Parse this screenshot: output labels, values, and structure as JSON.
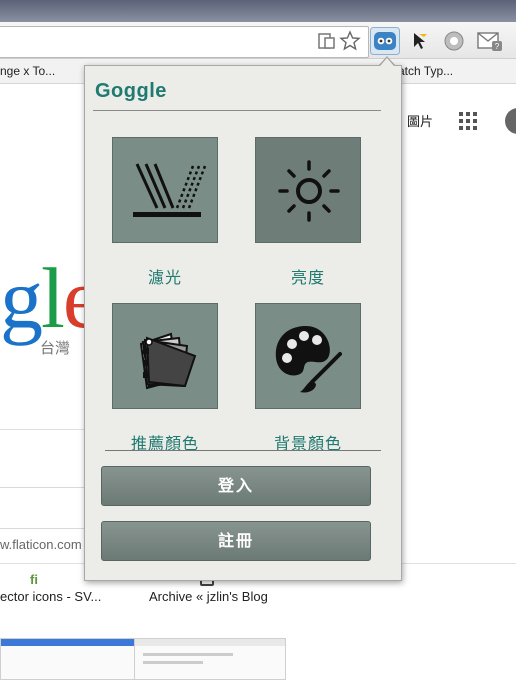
{
  "browser": {
    "bookmarks": [
      {
        "label": "nge x To..."
      },
      {
        "label": "atch Typ..."
      }
    ]
  },
  "page_behind": {
    "images_link": "圖片",
    "logo_fragment": "gle",
    "logo_region": "台灣",
    "url_fragment": "w.flaticon.com",
    "flaticon_logo": "fi",
    "tile_left_label": "ector icons - SV...",
    "tile_right_label": "Archive « jzlin's Blog"
  },
  "popup": {
    "title": "Goggle",
    "tiles": [
      {
        "label": "濾光",
        "icon": "light-filter-icon"
      },
      {
        "label": "亮度",
        "icon": "brightness-sun-icon"
      },
      {
        "label": "推薦顏色",
        "icon": "color-swatch-icon"
      },
      {
        "label": "背景顏色",
        "icon": "paint-palette-icon"
      }
    ],
    "login_button": "登入",
    "register_button": "註冊"
  },
  "colors": {
    "accent_teal": "#1f7a6f",
    "tile_bg": "#7a8e87",
    "popup_bg": "#ecece9"
  }
}
